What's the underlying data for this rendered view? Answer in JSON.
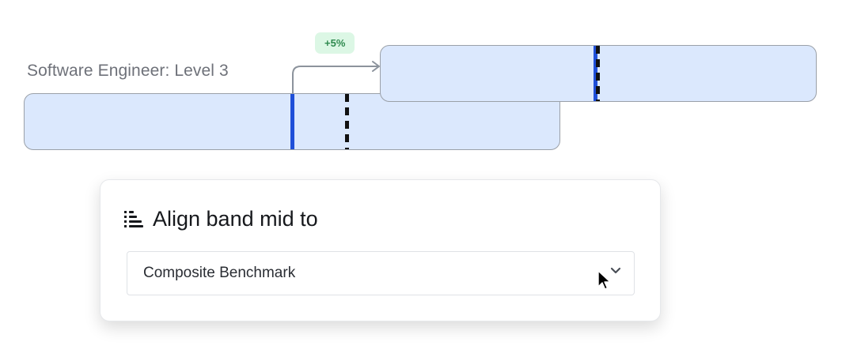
{
  "header": {
    "job_title": "Software Engineer: Level 3"
  },
  "comparison": {
    "shift_label": "+5%"
  },
  "align_panel": {
    "title": "Align band mid to",
    "title_icon": "align-left-bars-icon",
    "select": {
      "value": "Composite Benchmark",
      "icon": "chevron-down-icon"
    }
  },
  "colors": {
    "band_fill": "#dbe8fd",
    "band_border": "#9aa0a8",
    "band_mid_line": "#1f4fd8",
    "benchmark_line": "#111111",
    "badge_background": "#dcf7e5",
    "badge_text": "#2f8a4f"
  }
}
